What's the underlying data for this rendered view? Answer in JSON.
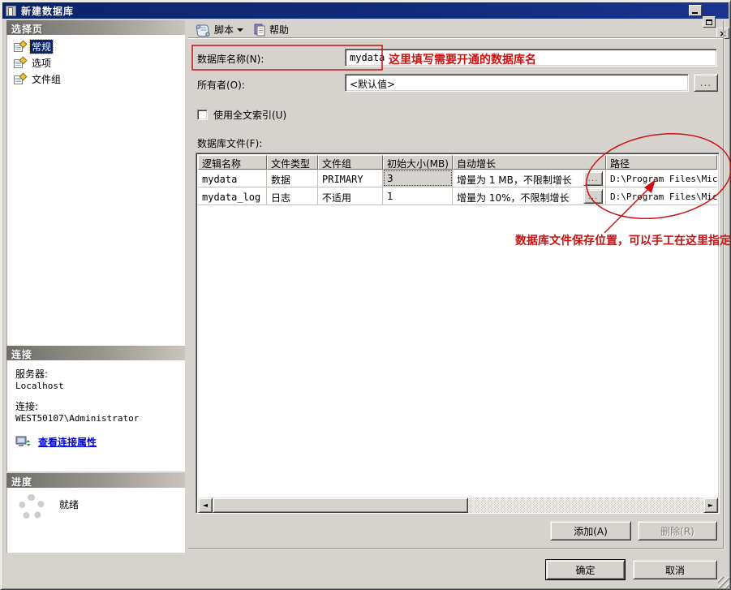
{
  "colors": {
    "titlebar": "#0a246a",
    "annotation_red": "#cc1111",
    "link_blue": "#0000ee",
    "select_blue": "#0a246a"
  },
  "window": {
    "title": "新建数据库"
  },
  "toolbar": {
    "script_label": "脚本",
    "help_label": "帮助"
  },
  "sidebar": {
    "header": "选择页",
    "items": [
      {
        "label": "常规"
      },
      {
        "label": "选项"
      },
      {
        "label": "文件组"
      }
    ],
    "connection": {
      "header": "连接",
      "server_label": "服务器:",
      "server_value": "Localhost",
      "conn_label": "连接:",
      "conn_value": "WEST50107\\Administrator",
      "view_props_link": "查看连接属性"
    },
    "progress": {
      "header": "进度",
      "status": "就绪"
    }
  },
  "form": {
    "db_name_label": "数据库名称(N):",
    "db_name_value": "mydata",
    "db_name_note": "这里填写需要开通的数据库名",
    "owner_label": "所有者(O):",
    "owner_value": "<默认值>",
    "browse_label": "...",
    "fulltext_label": "使用全文索引(U)",
    "files_label": "数据库文件(F):"
  },
  "table": {
    "columns": [
      "逻辑名称",
      "文件类型",
      "文件组",
      "初始大小(MB)",
      "自动增长",
      "路径"
    ],
    "rows": [
      {
        "name": "mydata",
        "type": "数据",
        "filegroup": "PRIMARY",
        "size": "3",
        "autogrow": "增量为 1 MB，不限制增长",
        "browse": "...",
        "path": "D:\\Program Files\\Micr"
      },
      {
        "name": "mydata_log",
        "type": "日志",
        "filegroup": "不适用",
        "size": "1",
        "autogrow": "增量为 10%，不限制增长",
        "browse": "...",
        "path": "D:\\Program Files\\Micr"
      }
    ]
  },
  "annotations": {
    "path_note": "数据库文件保存位置，可以手工在这里指定"
  },
  "scrollbar": {
    "left_glyph": "◄",
    "right_glyph": "►"
  },
  "buttons": {
    "add": "添加(A)",
    "remove": "删除(R)",
    "ok": "确定",
    "cancel": "取消"
  }
}
